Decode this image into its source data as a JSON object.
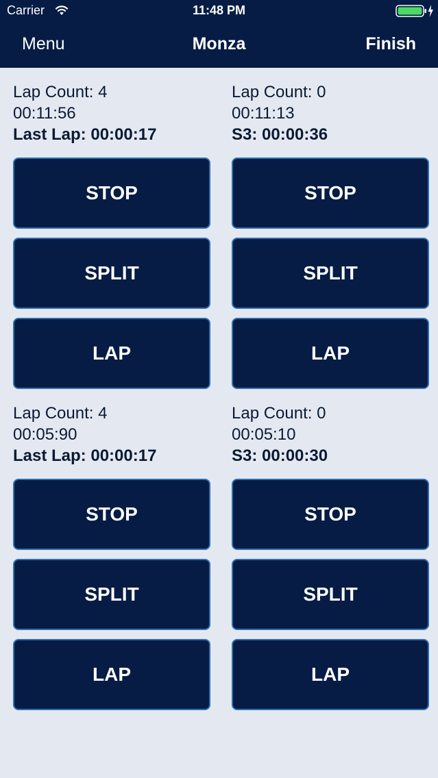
{
  "status_bar": {
    "carrier": "Carrier",
    "time": "11:48 PM",
    "icons": [
      "wifi-icon",
      "battery-icon",
      "charging-bolt-icon"
    ],
    "battery_color": "#4cd964"
  },
  "nav": {
    "left_label": "Menu",
    "title": "Monza",
    "right_label": "Finish"
  },
  "colors": {
    "bar_background": "#061c45",
    "page_background": "#e4e9f1",
    "button_background": "#061c45",
    "button_border": "#2f6fb1",
    "text": "#0b1a33"
  },
  "timers": [
    {
      "lap_count": "Lap Count: 4",
      "elapsed": "00:11:56",
      "detail": "Last Lap: 00:00:17",
      "buttons": {
        "stop": "STOP",
        "split": "SPLIT",
        "lap": "LAP"
      }
    },
    {
      "lap_count": "Lap Count: 0",
      "elapsed": "00:11:13",
      "detail": "S3: 00:00:36",
      "buttons": {
        "stop": "STOP",
        "split": "SPLIT",
        "lap": "LAP"
      }
    },
    {
      "lap_count": "Lap Count: 4",
      "elapsed": "00:05:90",
      "detail": "Last Lap: 00:00:17",
      "buttons": {
        "stop": "STOP",
        "split": "SPLIT",
        "lap": "LAP"
      }
    },
    {
      "lap_count": "Lap Count: 0",
      "elapsed": "00:05:10",
      "detail": "S3: 00:00:30",
      "buttons": {
        "stop": "STOP",
        "split": "SPLIT",
        "lap": "LAP"
      }
    }
  ]
}
